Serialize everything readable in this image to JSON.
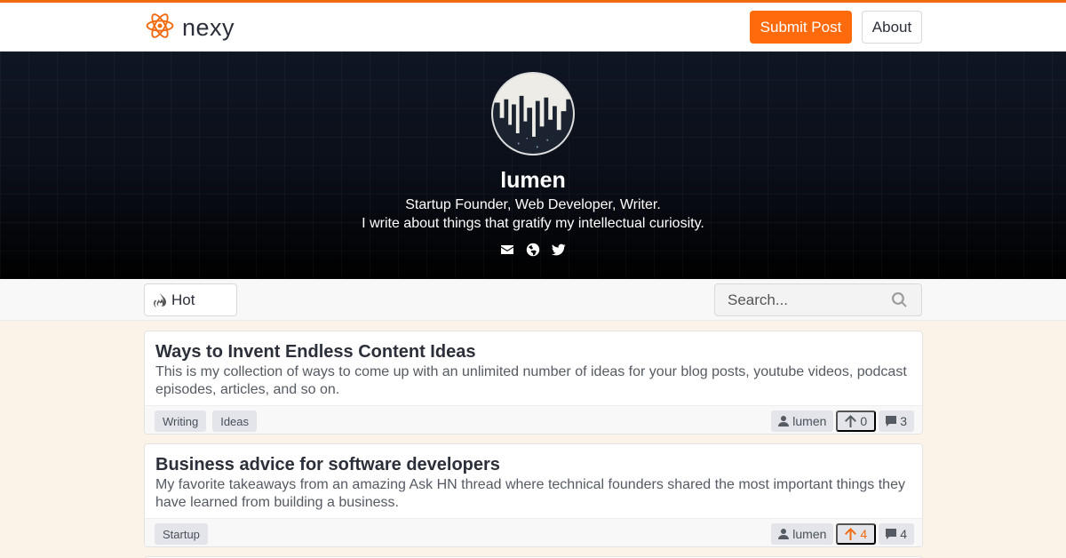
{
  "brand": {
    "name": "nexy",
    "color": "#f06a0f"
  },
  "nav": {
    "submit_label": "Submit Post",
    "about_label": "About"
  },
  "profile": {
    "name": "lumen",
    "bio_line1": "Startup Founder, Web Developer, Writer.",
    "bio_line2": "I write about things that gratify my intellectual curiosity.",
    "links": [
      "envelope-icon",
      "globe-icon",
      "twitter-icon"
    ]
  },
  "filter": {
    "sort_label": "Hot",
    "search_placeholder": "Search..."
  },
  "posts": [
    {
      "title": "Ways to Invent Endless Content Ideas",
      "description": "This is my collection of ways to come up with an unlimited number of ideas for your blog posts, youtube videos, podcast episodes, articles, and so on.",
      "tags": [
        "Writing",
        "Ideas"
      ],
      "author": "lumen",
      "upvotes": "0",
      "upvoted": false,
      "comments": "3"
    },
    {
      "title": "Business advice for software developers",
      "description": "My favorite takeaways from an amazing Ask HN thread where technical founders shared the most important things they have learned from building a business.",
      "tags": [
        "Startup"
      ],
      "author": "lumen",
      "upvotes": "4",
      "upvoted": true,
      "comments": "4"
    }
  ]
}
